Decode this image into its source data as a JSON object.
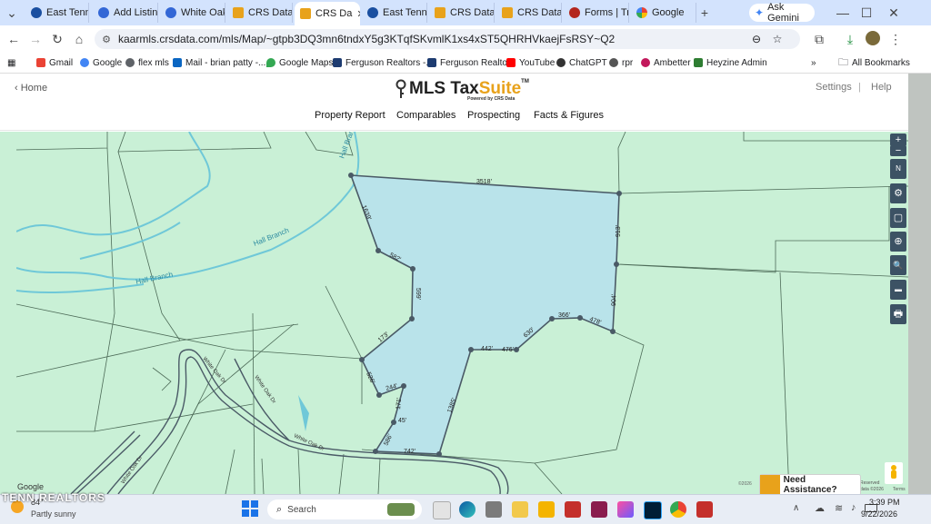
{
  "browser": {
    "tabs": [
      {
        "title": "East Tennes",
        "active": false
      },
      {
        "title": "Add Listing",
        "active": false
      },
      {
        "title": "White Oak",
        "active": false
      },
      {
        "title": "CRS Data -",
        "active": false
      },
      {
        "title": "CRS Da",
        "active": true
      },
      {
        "title": "East Tenne",
        "active": false
      },
      {
        "title": "CRS Data -",
        "active": false
      },
      {
        "title": "CRS Data -",
        "active": false
      },
      {
        "title": "Forms | Tra",
        "active": false
      },
      {
        "title": "Google",
        "active": false
      }
    ],
    "new_tab": "+",
    "ask_gemini": "Ask Gemini",
    "url": "kaarmls.crsdata.com/mls/Map/~gtpb3DQ3mn6tndxY5g3KTqfSKvmlK1xs4xST5QHRHVkaejFsRSY~Q2",
    "bookmarks": [
      "Gmail",
      "Google",
      "flex mls",
      "Mail - brian patty -...",
      "Google Maps",
      "Ferguson Realtors -...",
      "Ferguson Realtors",
      "YouTube",
      "ChatGPT",
      "rpr",
      "Ambetter",
      "Heyzine Admin"
    ],
    "all_bookmarks": "All Bookmarks"
  },
  "app": {
    "home": "‹ Home",
    "logo_text": "MLS Tax ",
    "logo_accent": "Suite",
    "logo_tm": "TM",
    "logo_sub": "Powered by CRS Data",
    "settings": "Settings",
    "separator": "|",
    "help": "Help",
    "nav": [
      "Property Report",
      "Comparables",
      "Prospecting",
      "Facts & Figures"
    ],
    "expand": "»"
  },
  "map": {
    "streams": [
      "Hall Branch",
      "Hall Branch",
      "Hall Branch"
    ],
    "roads": [
      "White Oak Dr",
      "White Oak Dr",
      "White Oak Dr",
      "White Oak Dr"
    ],
    "dimensions": [
      "3518'",
      "913'",
      "904'",
      "478'",
      "366'",
      "630'",
      "476'",
      "442'",
      "1385'",
      "742'",
      "586'",
      "171'",
      "244'",
      "526'",
      "173'",
      "599'",
      "582'",
      "1639'",
      "45'"
    ],
    "google": "Google",
    "copyright": "©2026",
    "reserved": "Reserved",
    "data_year": "data ©2026",
    "terms": "Terms",
    "assistance": "Need Assistance?",
    "controls": [
      "+",
      "−",
      "N",
      "⚙",
      "▢",
      "⊕",
      "🔍",
      "▬",
      "🖶"
    ]
  },
  "taskbar": {
    "weather_temp": "84°",
    "weather": "Partly sunny",
    "search": "Search",
    "time": "3:39 PM",
    "date": "9/22/2026",
    "watermark": "TENN REALTORS"
  },
  "colors": {
    "parcel_fill": "#b9e3ea",
    "parcel_stroke": "#4a5a66",
    "map_bg": "#c9f0d6",
    "stream": "#6fc8d8",
    "logo_accent": "#e8a21b"
  }
}
